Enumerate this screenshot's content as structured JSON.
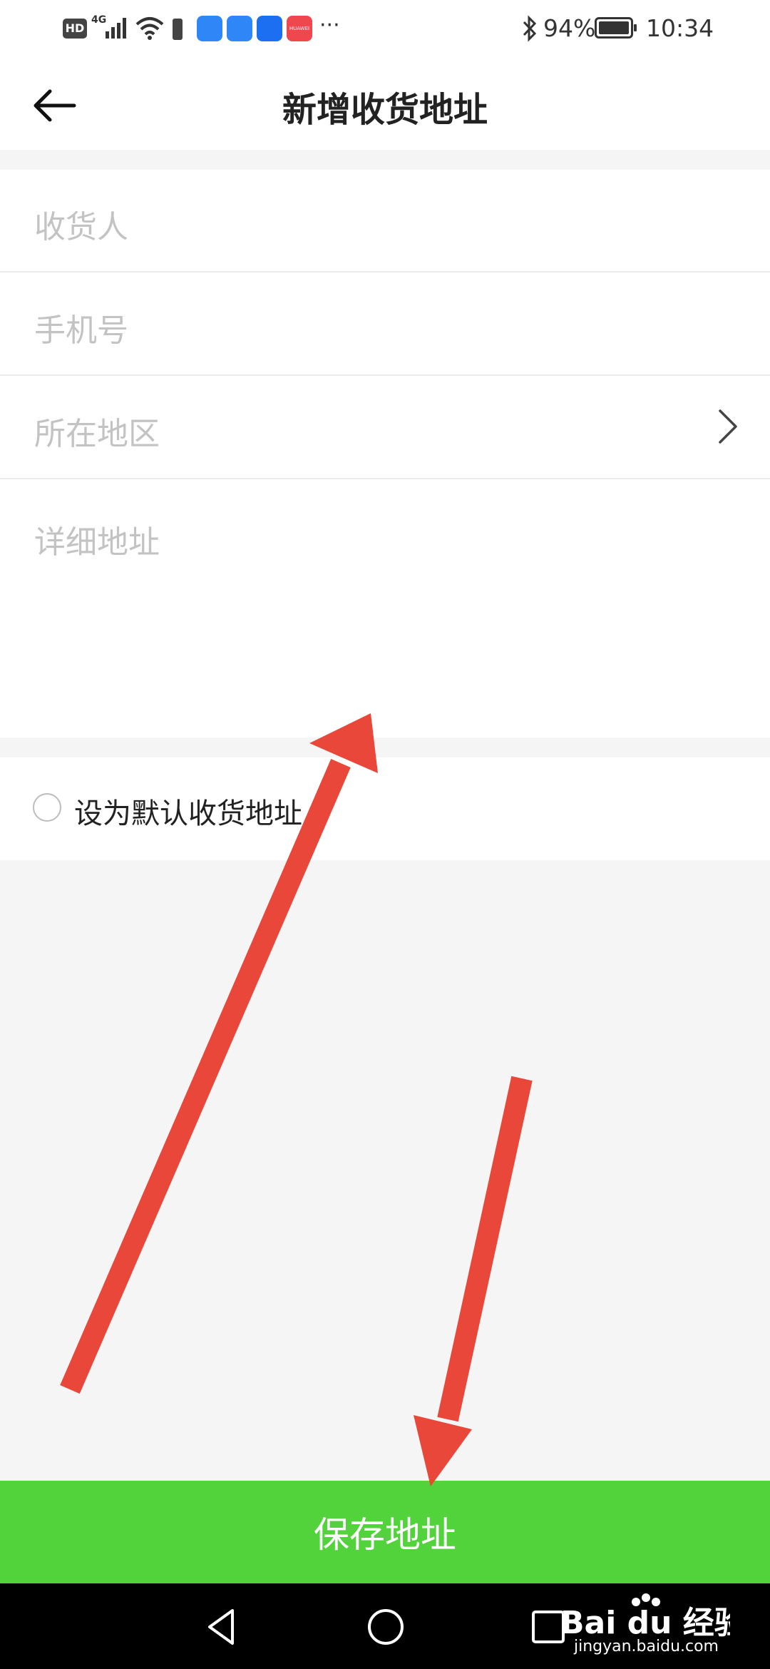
{
  "status_bar": {
    "hd": "HD",
    "network": "4G",
    "battery_percent": "94%",
    "time": "10:34",
    "more": "···",
    "app_badge": "HUAWEI"
  },
  "header": {
    "title": "新增收货地址",
    "back_icon": "arrow-left-icon"
  },
  "form": {
    "consignee_placeholder": "收货人",
    "phone_placeholder": "手机号",
    "region_placeholder": "所在地区",
    "address_placeholder": "详细地址"
  },
  "default_option": {
    "label": "设为默认收货地址",
    "checked": false
  },
  "save_button": {
    "label": "保存地址"
  },
  "watermark": {
    "brand": "Bai du 经验",
    "url": "jingyan.baidu.com"
  },
  "colors": {
    "accent_green": "#52d33c",
    "annotation_red": "#e8473a"
  }
}
